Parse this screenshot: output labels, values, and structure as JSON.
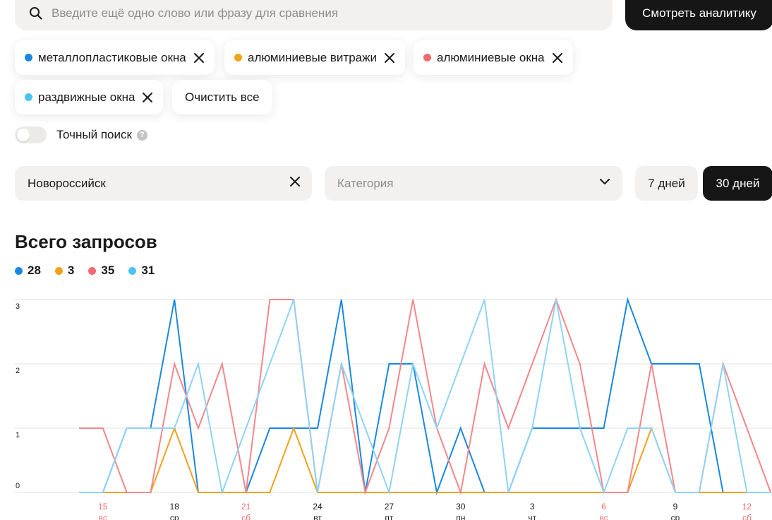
{
  "search": {
    "placeholder": "Введите ещё одно слово или фразу для сравнения",
    "value": ""
  },
  "analytics_button": "Смотреть аналитику",
  "keywords": [
    {
      "label": "металлопластиковые окна",
      "color": "#1a88e3"
    },
    {
      "label": "алюминиевые витражи",
      "color": "#f0a21c"
    },
    {
      "label": "алюминиевые окна",
      "color": "#f26a6d"
    },
    {
      "label": "раздвижные окна",
      "color": "#4cc3f5"
    }
  ],
  "clear_all": "Очистить все",
  "exact_search": {
    "label": "Точный поиск",
    "enabled": false,
    "help": "?"
  },
  "city": {
    "value": "Новороссийск"
  },
  "category": {
    "placeholder": "Категория"
  },
  "period": {
    "options": [
      "7 дней",
      "30 дней"
    ],
    "selected": "30 дней"
  },
  "chart_heading": "Всего запросов",
  "totals": [
    "28",
    "3",
    "35",
    "31"
  ],
  "chart_data": {
    "type": "line",
    "title": "Всего запросов",
    "ylim": [
      0,
      3
    ],
    "y_ticks": [
      "0",
      "1",
      "2",
      "3"
    ],
    "x_days": [
      "14",
      "15",
      "16",
      "17",
      "18",
      "19",
      "20",
      "21",
      "22",
      "23",
      "24",
      "25",
      "26",
      "27",
      "28",
      "29",
      "30",
      "1",
      "2",
      "3",
      "4",
      "5",
      "6",
      "7",
      "8",
      "9",
      "10",
      "11",
      "12",
      "13"
    ],
    "x_labels": [
      {
        "day": "15",
        "weekday": "вс",
        "weekend": true
      },
      {
        "day": "18",
        "weekday": "ср",
        "weekend": false
      },
      {
        "day": "21",
        "weekday": "сб",
        "weekend": true
      },
      {
        "day": "24",
        "weekday": "вт",
        "weekend": false
      },
      {
        "day": "27",
        "weekday": "пт",
        "weekend": false
      },
      {
        "day": "30",
        "weekday": "пн",
        "weekend": false
      },
      {
        "day": "3",
        "weekday": "чт",
        "weekend": false
      },
      {
        "day": "6",
        "weekday": "вс",
        "weekend": true
      },
      {
        "day": "9",
        "weekday": "ср",
        "weekend": false
      },
      {
        "day": "12",
        "weekday": "сб",
        "weekend": true
      }
    ],
    "grid": true,
    "series": [
      {
        "name": "металлопластиковые окна",
        "color": "#1a88e3",
        "values": [
          0,
          0,
          1,
          1,
          3,
          0,
          0,
          0,
          1,
          1,
          1,
          3,
          0,
          2,
          2,
          0,
          1,
          0,
          0,
          1,
          1,
          1,
          1,
          3,
          2,
          2,
          2,
          0,
          0,
          0
        ]
      },
      {
        "name": "алюминиевые витражи",
        "color": "#f0a21c",
        "values": [
          0,
          0,
          0,
          0,
          1,
          0,
          0,
          0,
          0,
          1,
          0,
          0,
          0,
          0,
          0,
          0,
          0,
          0,
          0,
          0,
          0,
          0,
          0,
          0,
          1,
          0,
          0,
          0,
          0,
          0
        ]
      },
      {
        "name": "алюминиевые окна",
        "color": "#f5878a",
        "values": [
          1,
          1,
          0,
          0,
          2,
          1,
          2,
          0,
          3,
          3,
          0,
          2,
          0,
          1,
          3,
          1,
          0,
          2,
          1,
          2,
          3,
          2,
          0,
          0,
          2,
          0,
          0,
          2,
          1,
          0
        ]
      },
      {
        "name": "раздвижные окна",
        "color": "#8fd3f7",
        "values": [
          0,
          0,
          1,
          1,
          1,
          2,
          0,
          1,
          2,
          3,
          0,
          2,
          1,
          0,
          2,
          1,
          2,
          3,
          0,
          1,
          3,
          1,
          0,
          1,
          1,
          0,
          0,
          2,
          0,
          0
        ]
      }
    ]
  }
}
